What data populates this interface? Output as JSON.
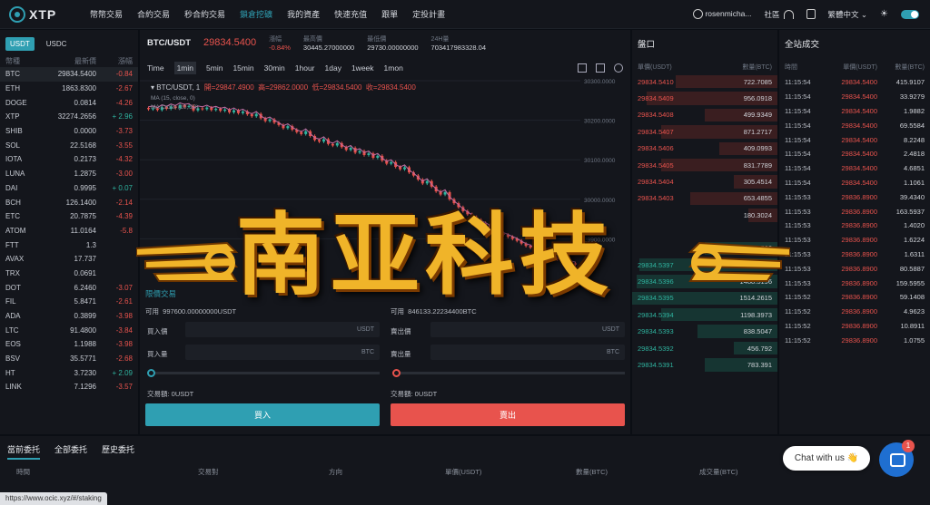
{
  "header": {
    "logo": "XTP",
    "nav": [
      "幣幣交易",
      "合約交易",
      "秒合約交易",
      "鎖倉挖礦",
      "我的資產",
      "快速充值",
      "跟單",
      "定投計畫"
    ],
    "active_nav_index": 3,
    "username": "rosenmicha...",
    "community": "社區",
    "language": "繁體中文"
  },
  "market": {
    "tabs": [
      "USDT",
      "USDC"
    ],
    "columns": [
      "幣種",
      "最新價",
      "漲幅"
    ],
    "rows": [
      {
        "sym": "BTC",
        "price": "29834.5400",
        "chg": "-0.84",
        "dir": "down"
      },
      {
        "sym": "ETH",
        "price": "1863.8300",
        "chg": "-2.67",
        "dir": "down"
      },
      {
        "sym": "DOGE",
        "price": "0.0814",
        "chg": "-4.26",
        "dir": "down"
      },
      {
        "sym": "XTP",
        "price": "32274.2656",
        "chg": "+ 2.96",
        "dir": "up"
      },
      {
        "sym": "SHIB",
        "price": "0.0000",
        "chg": "-3.73",
        "dir": "down"
      },
      {
        "sym": "SOL",
        "price": "22.5168",
        "chg": "-3.55",
        "dir": "down"
      },
      {
        "sym": "IOTA",
        "price": "0.2173",
        "chg": "-4.32",
        "dir": "down"
      },
      {
        "sym": "LUNA",
        "price": "1.2875",
        "chg": "-3.00",
        "dir": "down"
      },
      {
        "sym": "DAI",
        "price": "0.9995",
        "chg": "+ 0.07",
        "dir": "up"
      },
      {
        "sym": "BCH",
        "price": "126.1400",
        "chg": "-2.14",
        "dir": "down"
      },
      {
        "sym": "ETC",
        "price": "20.7875",
        "chg": "-4.39",
        "dir": "down"
      },
      {
        "sym": "ATOM",
        "price": "11.0164",
        "chg": "-5.8",
        "dir": "down"
      },
      {
        "sym": "FTT",
        "price": "1.3",
        "chg": "",
        "dir": "down"
      },
      {
        "sym": "AVAX",
        "price": "17.737",
        "chg": "",
        "dir": "down"
      },
      {
        "sym": "TRX",
        "price": "0.0691",
        "chg": "",
        "dir": "down"
      },
      {
        "sym": "DOT",
        "price": "6.2460",
        "chg": "-3.07",
        "dir": "down"
      },
      {
        "sym": "FIL",
        "price": "5.8471",
        "chg": "-2.61",
        "dir": "down"
      },
      {
        "sym": "ADA",
        "price": "0.3899",
        "chg": "-3.98",
        "dir": "down"
      },
      {
        "sym": "LTC",
        "price": "91.4800",
        "chg": "-3.84",
        "dir": "down"
      },
      {
        "sym": "EOS",
        "price": "1.1988",
        "chg": "-3.98",
        "dir": "down"
      },
      {
        "sym": "BSV",
        "price": "35.5771",
        "chg": "-2.68",
        "dir": "down"
      },
      {
        "sym": "HT",
        "price": "3.7230",
        "chg": "+ 2.09",
        "dir": "up"
      },
      {
        "sym": "LINK",
        "price": "7.1296",
        "chg": "-3.57",
        "dir": "down"
      }
    ]
  },
  "ticker": {
    "symbol": "BTC/USDT",
    "price": "29834.5400",
    "change_label": "漲幅",
    "change": "-0.84%",
    "high_label": "最高價",
    "high": "30445.27000000",
    "low_label": "最低價",
    "low": "29730.00000000",
    "vol_label": "24H量",
    "vol": "703417983328.04"
  },
  "timeframes": [
    "Time",
    "1min",
    "5min",
    "15min",
    "30min",
    "1hour",
    "1day",
    "1week",
    "1mon"
  ],
  "chart_info": {
    "pair": "BTC/USDT, 1",
    "open": "開=29847.4900",
    "high": "高=29862.0000",
    "low": "低=29834.5400",
    "close": "收=29834.5400",
    "ma1": "MA (15, close, 0)",
    "ma2": "MA Cross (10, 20)"
  },
  "chart_data": {
    "type": "line",
    "y_ticks": [
      "30300.0000",
      "30200.0000",
      "30100.0000",
      "30000.0000",
      "29900.0000"
    ],
    "ylim": [
      29800,
      30300
    ],
    "close_series": [
      30228,
      30230,
      30226,
      30233,
      30229,
      30235,
      30231,
      30238,
      30234,
      30236,
      30225,
      30230,
      30228,
      30232,
      30226,
      30229,
      30224,
      30227,
      30220,
      30225,
      30218,
      30222,
      30215,
      30210,
      30216,
      30205,
      30198,
      30202,
      30194,
      30188,
      30180,
      30185,
      30176,
      30170,
      30165,
      30172,
      30160,
      30150,
      30146,
      30152,
      30140,
      30136,
      30142,
      30132,
      30125,
      30130,
      30118,
      30122,
      30112,
      30116,
      30105,
      30110,
      30098,
      30090,
      30094,
      30082,
      30076,
      30081,
      30068,
      30060,
      30050,
      30040,
      30046,
      30032,
      30020,
      30012,
      30018,
      30000,
      29990,
      29980,
      29970,
      29962,
      29955,
      29948,
      29940,
      29935,
      29928,
      29920,
      29915,
      29910,
      29905,
      29900,
      29895,
      29888,
      29882,
      29878,
      29870,
      29865,
      29860,
      29856,
      29852,
      29848,
      29844,
      29840,
      29838,
      29835
    ]
  },
  "order_form": {
    "tab": "限價交易",
    "buy_avail_label": "可用",
    "buy_avail": "997600.00000000USDT",
    "sell_avail_label": "可用",
    "sell_avail": "846133.22234400BTC",
    "buy_price_label": "買入價",
    "buy_qty_label": "買入量",
    "sell_price_label": "賣出價",
    "sell_qty_label": "賣出量",
    "usdt": "USDT",
    "btc": "BTC",
    "buy_amount": "交易額: 0USDT",
    "sell_amount": "交易額: 0USDT",
    "buy_btn": "買入",
    "sell_btn": "賣出"
  },
  "book": {
    "title": "盤口",
    "col_price": "單價(USDT)",
    "col_qty": "數量(BTC)",
    "asks": [
      {
        "p": "29834.5410",
        "q": "722.7085",
        "w": 0.7
      },
      {
        "p": "29834.5409",
        "q": "956.0918",
        "w": 0.9
      },
      {
        "p": "29834.5408",
        "q": "499.9349",
        "w": 0.5
      },
      {
        "p": "29834.5407",
        "q": "871.2717",
        "w": 0.8
      },
      {
        "p": "29834.5406",
        "q": "409.0993",
        "w": 0.4
      },
      {
        "p": "29834.5405",
        "q": "831.7789",
        "w": 0.8
      },
      {
        "p": "29834.5404",
        "q": "305.4514",
        "w": 0.3
      },
      {
        "p": "29834.5403",
        "q": "653.4855",
        "w": 0.6
      },
      {
        "p": "",
        "q": "180.3024",
        "w": 0.2
      }
    ],
    "bids": [
      {
        "p": "",
        "q": "562.8562",
        "w": 0.5
      },
      {
        "p": "29834.5397",
        "q": "1463.1907",
        "w": 0.95
      },
      {
        "p": "29834.5396",
        "q": "1488.5196",
        "w": 0.97
      },
      {
        "p": "29834.5395",
        "q": "1514.2615",
        "w": 1.0
      },
      {
        "p": "29834.5394",
        "q": "1198.3973",
        "w": 0.8
      },
      {
        "p": "29834.5393",
        "q": "838.5047",
        "w": 0.55
      },
      {
        "p": "29834.5392",
        "q": "456.792",
        "w": 0.3
      },
      {
        "p": "29834.5391",
        "q": "783.391",
        "w": 0.5
      }
    ]
  },
  "trades": {
    "title": "全站成交",
    "cols": [
      "時間",
      "單價(USDT)",
      "數量(BTC)"
    ],
    "rows": [
      [
        "11:15:54",
        "29834.5400",
        "415.9107"
      ],
      [
        "11:15:54",
        "29834.5400",
        "33.9279"
      ],
      [
        "11:15:54",
        "29834.5400",
        "1.9882"
      ],
      [
        "11:15:54",
        "29834.5400",
        "69.5584"
      ],
      [
        "11:15:54",
        "29834.5400",
        "8.2248"
      ],
      [
        "11:15:54",
        "29834.5400",
        "2.4818"
      ],
      [
        "11:15:54",
        "29834.5400",
        "4.6851"
      ],
      [
        "11:15:54",
        "29834.5400",
        "1.1061"
      ],
      [
        "11:15:53",
        "29836.8900",
        "39.4340"
      ],
      [
        "11:15:53",
        "29836.8900",
        "163.5937"
      ],
      [
        "11:15:53",
        "29836.8900",
        "1.4020"
      ],
      [
        "11:15:53",
        "29836.8900",
        "1.6224"
      ],
      [
        "11:15:53",
        "29836.8900",
        "1.6311"
      ],
      [
        "11:15:53",
        "29836.8900",
        "80.5887"
      ],
      [
        "11:15:53",
        "29836.8900",
        "159.5955"
      ],
      [
        "11:15:52",
        "29836.8900",
        "59.1408"
      ],
      [
        "11:15:52",
        "29836.8900",
        "4.9623"
      ],
      [
        "11:15:52",
        "29836.8900",
        "10.8911"
      ],
      [
        "11:15:52",
        "29836.8900",
        "1.0755"
      ]
    ]
  },
  "orders": {
    "tabs": [
      "當前委托",
      "全部委托",
      "歷史委托"
    ],
    "cols": [
      "時間",
      "交易對",
      "方向",
      "單價(USDT)",
      "數量(BTC)",
      "成交量(BTC)"
    ]
  },
  "status_url": "https://www.ocic.xyz/#/staking",
  "chat": {
    "label": "Chat with us 👋",
    "badge": "1"
  },
  "watermark": "南亚科技"
}
